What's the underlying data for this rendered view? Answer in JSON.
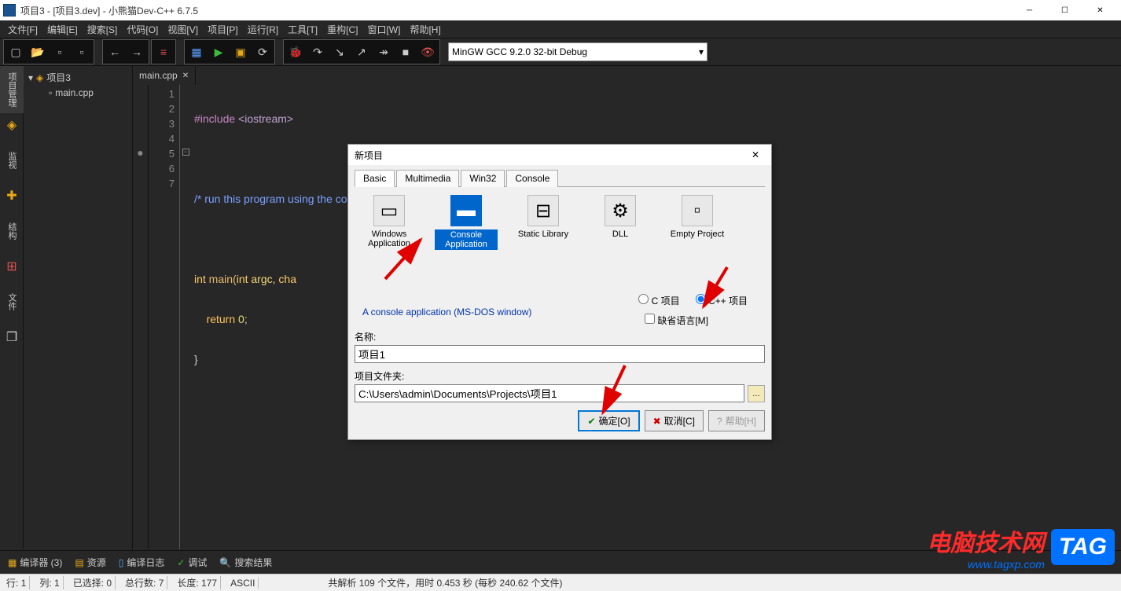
{
  "title": "项目3 - [项目3.dev] - 小熊猫Dev-C++ 6.7.5",
  "menu": [
    "文件[F]",
    "编辑[E]",
    "搜索[S]",
    "代码[O]",
    "视图[V]",
    "项目[P]",
    "运行[R]",
    "工具[T]",
    "重构[C]",
    "窗口[W]",
    "帮助[H]"
  ],
  "compiler": "MinGW GCC 9.2.0 32-bit Debug",
  "vtabs": {
    "proj": "项目管理",
    "watch": "监视",
    "struct": "结构",
    "file": "文件"
  },
  "project_tree": {
    "root": "项目3",
    "files": [
      "main.cpp"
    ]
  },
  "file_tab": "main.cpp",
  "code": {
    "l1a": "#include ",
    "l1b": "<iostream>",
    "l3": "/* run this program using the console pauser or add your own getch, system(\"pause\") or input loop */",
    "l5a": "int",
    "l5b": " main(",
    "l5c": "int",
    "l5d": " argc, ",
    "l5e": "cha",
    "l6a": "    ",
    "l6b": "return",
    "l6c": " ",
    "l6d": "0",
    "l6e": ";",
    "l7": "}"
  },
  "dialog": {
    "title": "新项目",
    "tabs": [
      "Basic",
      "Multimedia",
      "Win32",
      "Console"
    ],
    "templates": [
      {
        "name": "Windows Application"
      },
      {
        "name": "Console Application"
      },
      {
        "name": "Static Library"
      },
      {
        "name": "DLL"
      },
      {
        "name": "Empty Project"
      }
    ],
    "desc": "A console application (MS-DOS window)",
    "radio_c": "C 项目",
    "radio_cpp": "C++ 项目",
    "check_default": "缺省语言[M]",
    "name_label": "名称:",
    "name_value": "项目1",
    "folder_label": "项目文件夹:",
    "folder_value": "C:\\Users\\admin\\Documents\\Projects\\项目1",
    "btn_ok": "确定[O]",
    "btn_cancel": "取消[C]",
    "btn_help": "帮助[H]"
  },
  "bottom": {
    "compiler": "编译器 (3)",
    "resource": "资源",
    "log": "编译日志",
    "debug": "调试",
    "search": "搜索结果"
  },
  "status": {
    "line": "行: 1",
    "col": "列: 1",
    "sel": "已选择: 0",
    "total": "总行数: 7",
    "len": "长度: 177",
    "enc": "ASCII",
    "parse": "共解析 109 个文件，用时 0.453 秒 (每秒 240.62 个文件)"
  },
  "watermark": {
    "cn": "电脑技术网",
    "url": "www.tagxp.com",
    "tag": "TAG"
  }
}
